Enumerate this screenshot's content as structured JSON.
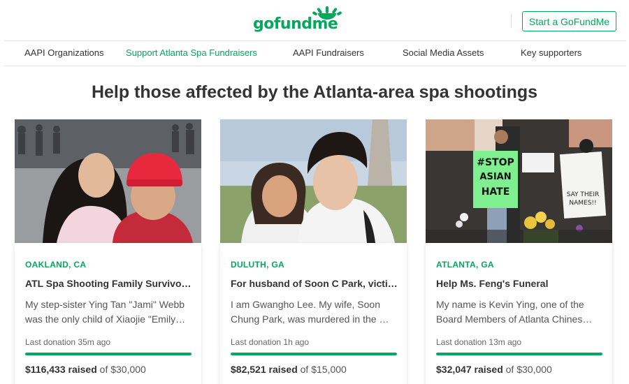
{
  "header": {
    "logo_text": "gofundme",
    "start_button": "Start a GoFundMe",
    "brand_color": "#02a95c"
  },
  "subnav": {
    "items": [
      {
        "label": "AAPI Organizations",
        "active": false
      },
      {
        "label": "Support Atlanta Spa Fundraisers",
        "active": true
      },
      {
        "label": "AAPI Fundraisers",
        "active": false
      },
      {
        "label": "Social Media Assets",
        "active": false
      },
      {
        "label": "Key supporters",
        "active": false
      }
    ]
  },
  "headline": "Help those affected by the Atlanta-area spa shootings",
  "cards": [
    {
      "location": "OAKLAND, CA",
      "title": "ATL Spa Shooting Family Survivor…",
      "desc_line1": "My step-sister Ying Tan \"Jami\" Webb",
      "desc_line2": "was the only child of Xiaojie \"Emily…",
      "last_donation": "Last donation 35m ago",
      "progress": 1.0,
      "raised_amount": "$116,433 raised",
      "goal_text": "of $30,000"
    },
    {
      "location": "DULUTH, GA",
      "title": "For husband of Soon C Park, victi…",
      "desc_line1": "I am Gwangho Lee. My wife, Soon",
      "desc_line2": "Chung Park, was murdered in the …",
      "last_donation": "Last donation 1h ago",
      "progress": 1.0,
      "raised_amount": "$82,521 raised",
      "goal_text": "of $15,000"
    },
    {
      "location": "ATLANTA, GA",
      "title": "Help Ms. Feng's Funeral",
      "desc_line1": "My name is Kevin Ying, one of the",
      "desc_line2": "Board Members of Atlanta Chines…",
      "last_donation": "Last donation 13m ago",
      "progress": 1.0,
      "raised_amount": "$32,047 raised",
      "goal_text": "of $30,000"
    }
  ],
  "images": {
    "card1": {
      "sign_text": ""
    },
    "card3": {
      "sign_main": "STOP ASIAN HATE",
      "sign_side": "SAY THEIR NAMES!!"
    }
  }
}
